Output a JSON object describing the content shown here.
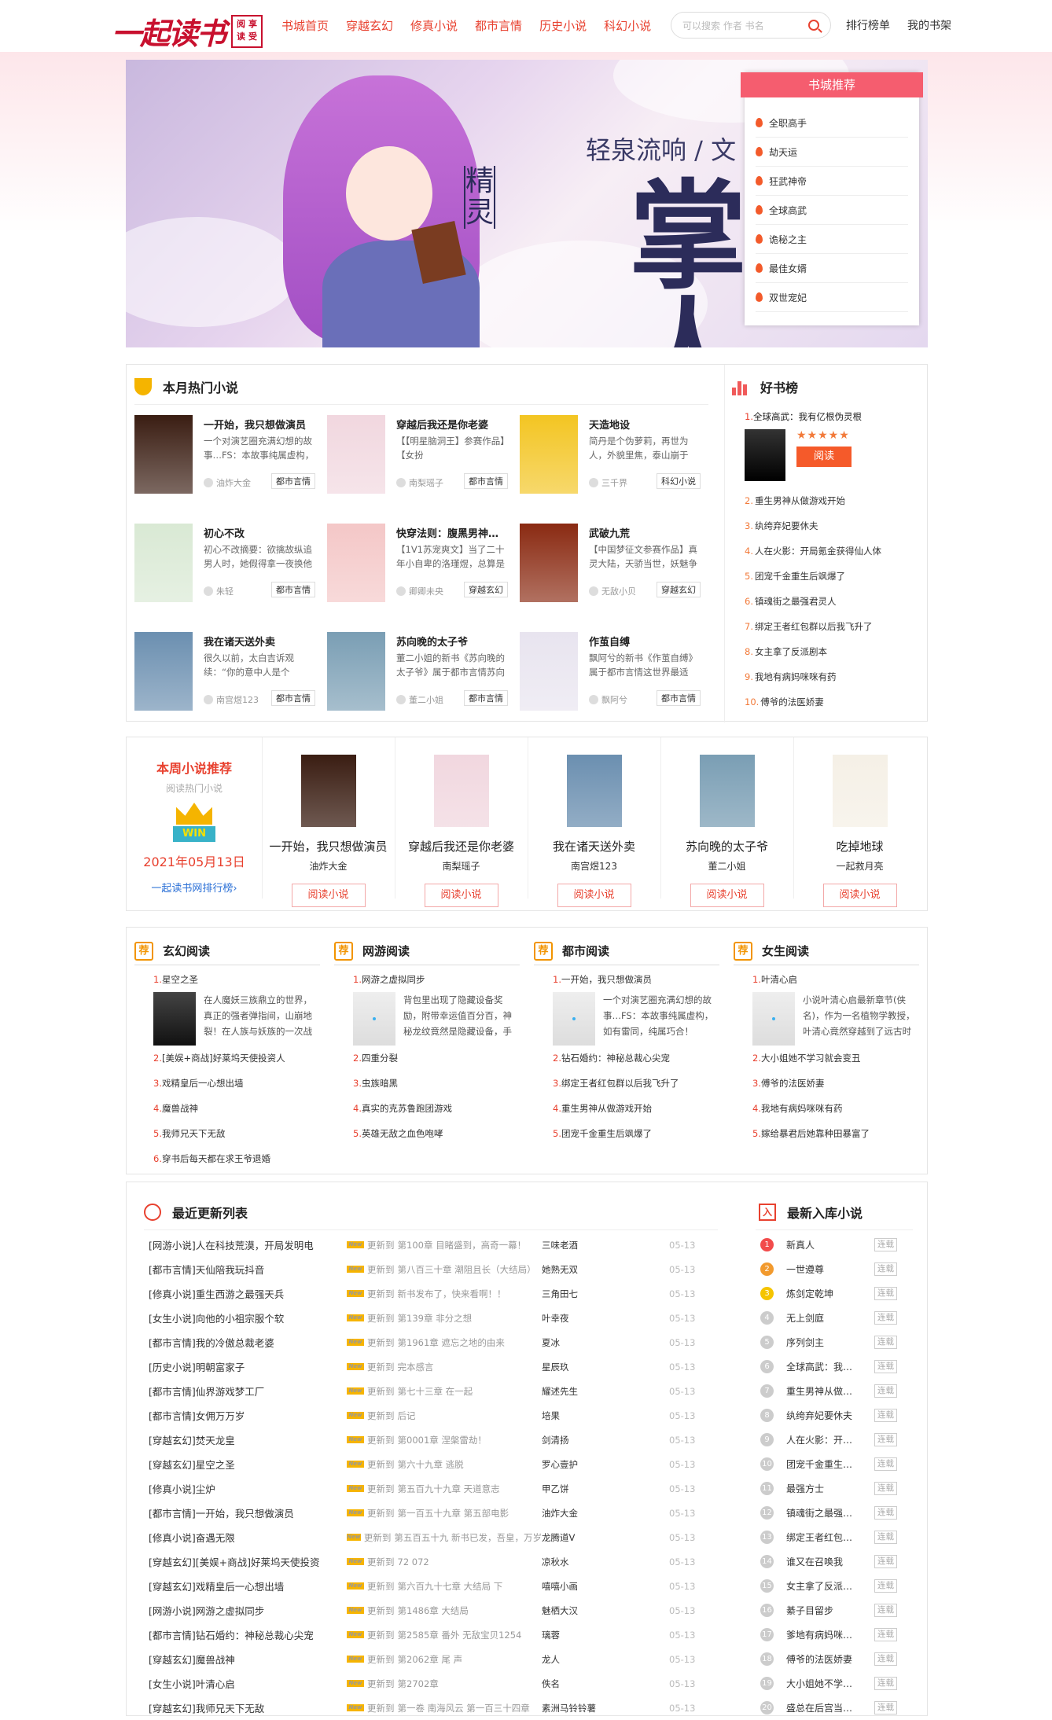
{
  "header": {
    "logo": "一起读书",
    "logo_seal": [
      "阅",
      "享",
      "读",
      "受"
    ],
    "nav": [
      "书城首页",
      "穿越玄幻",
      "修真小说",
      "都市言情",
      "历史小说",
      "科幻小说"
    ],
    "search_placeholder": "可以搜索 作者 书名",
    "right_links": [
      "排行榜单",
      "我的书架"
    ]
  },
  "banner": {
    "author": "轻泉流响 / 文",
    "subtitle": "精灵",
    "title": "掌门人"
  },
  "recommend": {
    "title": "书城推荐",
    "items": [
      "全职高手",
      "劫天运",
      "狂武神帝",
      "全球高武",
      "诡秘之主",
      "最佳女婿",
      "双世宠妃"
    ]
  },
  "monthly_hot": {
    "title": "本月热门小说",
    "books": [
      {
        "title": "一开始，我只想做演员",
        "desc": "一个对演艺圈充满幻想的故事…FS：本故事纯属虚构，",
        "author": "油炸大金",
        "tag": "都市言情",
        "cover": "#3a1d12"
      },
      {
        "title": "穿越后我还是你老婆",
        "desc": "【【明星脑洞王】参赛作品】【女扮",
        "author": "南梨瑶子",
        "tag": "都市言情",
        "cover": "#f1d7df"
      },
      {
        "title": "天造地设",
        "desc": "简丹是个伪萝莉，再世为人，外貌里焦，泰山崩于",
        "author": "三千界",
        "tag": "科幻小说",
        "cover": "#f3c522"
      },
      {
        "title": "初心不改",
        "desc": "初心不改摘要：欲擒故纵追男人时，她假得拿一夜换他",
        "author": "朱轻",
        "tag": "都市言情",
        "cover": "#d9e9d4"
      },
      {
        "title": "快穿法则：腹黑男神…",
        "desc": "【1V1苏宠爽文】当了二十年小自卑的洛瑾煜，总算是",
        "author": "卿卿未央",
        "tag": "穿越玄幻",
        "cover": "#f4c7c7"
      },
      {
        "title": "武破九荒",
        "desc": "【中国梦征文参赛作品】真灵大陆，天骄当世，妖魅争",
        "author": "无敌小贝",
        "tag": "穿越玄幻",
        "cover": "#8a2a12"
      },
      {
        "title": "我在诸天送外卖",
        "desc": "很久以前，太白吉诉观续：“你的意中人是个",
        "author": "南宫煜123",
        "tag": "都市言情",
        "cover": "#6b8fb0"
      },
      {
        "title": "苏向晚的太子爷",
        "desc": "董二小姐的新书《苏向晚的太子爷》属于都市言情苏向",
        "author": "董二小姐",
        "tag": "都市言情",
        "cover": "#7a9eb4"
      },
      {
        "title": "作茧自缚",
        "desc": "飘阿兮的新书《作茧自缚》属于都市言情这世界最适",
        "author": "飘阿兮",
        "tag": "都市言情",
        "cover": "#e8e4ef"
      }
    ]
  },
  "good_books": {
    "title": "好书榜",
    "top": {
      "name": "全球高武：我有亿根伪灵根",
      "stars": "★★★★★",
      "button": "阅读"
    },
    "items": [
      "重生男神从做游戏开始",
      "纨绔弃妃要休夫",
      "人在火影：开局氪金获得仙人体",
      "团宠千金重生后飒爆了",
      "镇魂街之最强君灵人",
      "绑定王者红包群以后我飞升了",
      "女主拿了反派剧本",
      "我地有病妈咪咪有药",
      "傅爷的法医娇妻"
    ]
  },
  "weekly": {
    "title": "本周小说推荐",
    "subtitle": "阅读热门小说",
    "badge": "WIN",
    "date": "2021年05月13日",
    "link": "一起读书网排行榜",
    "books": [
      {
        "title": "一开始，我只想做演员",
        "author": "油炸大金",
        "button": "阅读小说",
        "cover": "#3a1d12"
      },
      {
        "title": "穿越后我还是你老婆",
        "author": "南梨瑶子",
        "button": "阅读小说",
        "cover": "#f1d7df"
      },
      {
        "title": "我在诸天送外卖",
        "author": "南宫煜123",
        "button": "阅读小说",
        "cover": "#6b8fb0"
      },
      {
        "title": "苏向晚的太子爷",
        "author": "董二小姐",
        "button": "阅读小说",
        "cover": "#7a9eb4"
      },
      {
        "title": "吃掉地球",
        "author": "一起救月亮",
        "button": "阅读小说",
        "cover": "#f5f0e6"
      }
    ]
  },
  "categories": [
    {
      "name": "玄幻阅读",
      "first": "星空之圣",
      "desc": "在人魔妖三族鼎立的世界，真正的强者弹指间，山崩地裂！在人族与妖族的一次战",
      "items": [
        "[美娱+商战]好莱坞天使投资人",
        "戏精皇后一心想出墙",
        "魔兽战神",
        "我师兄天下无敌",
        "穿书后每天都在求王爷退婚"
      ]
    },
    {
      "name": "网游阅读",
      "first": "网游之虚拟同步",
      "desc": "背包里出现了隐藏设备奖励，附带幸运值百分百，神秘龙纹竟然是隐藏设备，手",
      "items": [
        "四重分裂",
        "虫族暗黑",
        "真实的克苏鲁跑团游戏",
        "英雄无敌之血色咆哮"
      ]
    },
    {
      "name": "都市阅读",
      "first": "一开始，我只想做演员",
      "desc": "一个对演艺圈充满幻想的故事…FS：本故事纯属虚构，如有雷同，纯属巧合！",
      "items": [
        "钻石婚约：神秘总裁心尖宠",
        "绑定王者红包群以后我飞升了",
        "重生男神从做游戏开始",
        "团宠千金重生后飒爆了"
      ]
    },
    {
      "name": "女生阅读",
      "first": "叶清心启",
      "desc": "小说叶清心启最新章节(侠名)，作为一名植物学教授，叶清心竟然穿越到了远古时",
      "items": [
        "大小姐她不学习就会变丑",
        "傅爷的法医娇妻",
        "我地有病妈咪咪有药",
        "嫁给暴君后她靠种田暴富了"
      ]
    }
  ],
  "updates": {
    "title": "最近更新列表",
    "prefix": "更新到",
    "new_label": "New",
    "rows": [
      {
        "cat": "[网游小说]",
        "name": "人在科技荒漠，开局发明电",
        "ch": "第100章 目睹盛到，高奇一幕！",
        "au": "三味老酒",
        "dt": "05-13"
      },
      {
        "cat": "[都市言情]",
        "name": "天仙陪我玩抖音",
        "ch": "第八百三十章 潮阻且长（大结局）",
        "au": "她熟无双",
        "dt": "05-13"
      },
      {
        "cat": "[修真小说]",
        "name": "重生西游之最强天兵",
        "ch": "新书发布了，快来看啊！！",
        "au": "三角田七",
        "dt": "05-13"
      },
      {
        "cat": "[女生小说]",
        "name": "向他的小祖宗服个软",
        "ch": "第139章 非分之想",
        "au": "叶幸夜",
        "dt": "05-13"
      },
      {
        "cat": "[都市言情]",
        "name": "我的冷傲总裁老婆",
        "ch": "第1961章 遮忘之地的由来",
        "au": "夏冰",
        "dt": "05-13"
      },
      {
        "cat": "[历史小说]",
        "name": "明朝富家子",
        "ch": "完本感言",
        "au": "星辰玖",
        "dt": "05-13"
      },
      {
        "cat": "[都市言情]",
        "name": "仙界游戏梦工厂",
        "ch": "第七十三章 在一起",
        "au": "耀述先生",
        "dt": "05-13"
      },
      {
        "cat": "[都市言情]",
        "name": "女佣万万岁",
        "ch": "后记",
        "au": "培果",
        "dt": "05-13"
      },
      {
        "cat": "[穿越玄幻]",
        "name": "焚天龙皇",
        "ch": "第0001章 涅槃雷劫！",
        "au": "剑清扬",
        "dt": "05-13"
      },
      {
        "cat": "[穿越玄幻]",
        "name": "星空之圣",
        "ch": "第六十九章 逃脱",
        "au": "罗心壹护",
        "dt": "05-13"
      },
      {
        "cat": "[修真小说]",
        "name": "尘炉",
        "ch": "第五百九十九章 天道意志",
        "au": "甲乙饼",
        "dt": "05-13"
      },
      {
        "cat": "[都市言情]",
        "name": "一开始，我只想做演员",
        "ch": "第一百五十九章 第五部电影",
        "au": "油炸大金",
        "dt": "05-13"
      },
      {
        "cat": "[修真小说]",
        "name": "奋遇无限",
        "ch": "第五百五十九 新书已发，吾皇，万岁",
        "au": "龙腾道V",
        "dt": "05-13"
      },
      {
        "cat": "[穿越玄幻]",
        "name": "[美娱+商战]好莱坞天使投资",
        "ch": "72 072",
        "au": "凉秋水",
        "dt": "05-13"
      },
      {
        "cat": "[穿越玄幻]",
        "name": "戏精皇后一心想出墙",
        "ch": "第六百九十七章 大结局 下",
        "au": "嘻嘻小画",
        "dt": "05-13"
      },
      {
        "cat": "[网游小说]",
        "name": "网游之虚拟同步",
        "ch": "第1486章 大结局",
        "au": "魅栖大汉",
        "dt": "05-13"
      },
      {
        "cat": "[都市言情]",
        "name": "钻石婚约：神秘总裁心尖宠",
        "ch": "第2585章 番外 无敌宝贝1254",
        "au": "璃蓉",
        "dt": "05-13"
      },
      {
        "cat": "[穿越玄幻]",
        "name": "魔兽战神",
        "ch": "第2062章 尾 声",
        "au": "龙人",
        "dt": "05-13"
      },
      {
        "cat": "[女生小说]",
        "name": "叶清心启",
        "ch": "第2702章",
        "au": "佚名",
        "dt": "05-13"
      },
      {
        "cat": "[穿越玄幻]",
        "name": "我师兄天下无敌",
        "ch": "第一卷 南海风云 第一百三十四章",
        "au": "素洲马铃铃薯",
        "dt": "05-13"
      }
    ]
  },
  "new_books": {
    "title": "最新入库小说",
    "tag": "连载",
    "items": [
      "新真人",
      "一世遵尊",
      "炼剑定乾坤",
      "无上剑庭",
      "序列剑主",
      "全球高武：我…",
      "重生男神从做…",
      "纨绔弃妃要休夫",
      "人在火影：开…",
      "团宠千金重生…",
      "最强方士",
      "镇魂街之最强…",
      "绑定王者红包…",
      "谁又在召唤我",
      "女主拿了反派…",
      "綦子目留步",
      "爹地有病妈咪…",
      "傅爷的法医娇妻",
      "大小姐她不学…",
      "盛总在后宫当…"
    ],
    "colors": [
      "#f24b4b",
      "#f29a2e",
      "#f5c400"
    ]
  }
}
